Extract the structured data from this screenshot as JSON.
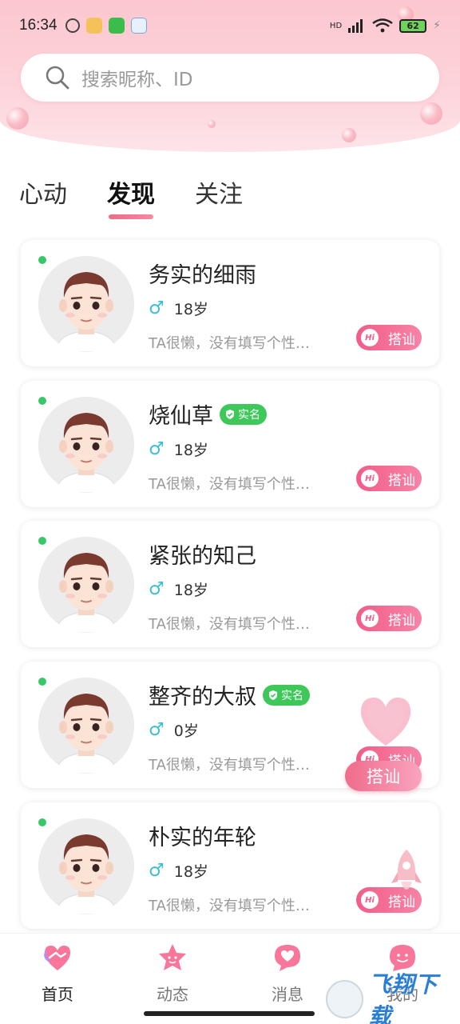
{
  "status_bar": {
    "time": "16:34",
    "signal": "HD",
    "battery": "62"
  },
  "search": {
    "placeholder": "搜索昵称、ID"
  },
  "tabs": [
    {
      "label": "心动",
      "active": false
    },
    {
      "label": "发现",
      "active": true
    },
    {
      "label": "关注",
      "active": false
    }
  ],
  "users": [
    {
      "name": "务实的细雨",
      "verified": false,
      "gender": "♂",
      "age": "18岁",
      "bio": "TA很懒，没有填写个性…",
      "online": true,
      "button": "搭讪",
      "hi": "Hi"
    },
    {
      "name": "烧仙草",
      "verified": true,
      "verified_label": "实名",
      "gender": "♂",
      "age": "18岁",
      "bio": "TA很懒，没有填写个性…",
      "online": true,
      "button": "搭讪",
      "hi": "Hi"
    },
    {
      "name": "紧张的知己",
      "verified": false,
      "gender": "♂",
      "age": "18岁",
      "bio": "TA很懒，没有填写个性…",
      "online": true,
      "button": "搭讪",
      "hi": "Hi"
    },
    {
      "name": "整齐的大叔",
      "verified": true,
      "verified_label": "实名",
      "gender": "♂",
      "age": "0岁",
      "bio": "TA很懒，没有填写个性…",
      "online": true,
      "button": "搭讪",
      "hi": "Hi"
    },
    {
      "name": "朴实的年轮",
      "verified": false,
      "gender": "♂",
      "age": "18岁",
      "bio": "TA很懒，没有填写个性…",
      "online": true,
      "button": "搭讪",
      "hi": "Hi"
    }
  ],
  "floating": {
    "chat_label": "搭讪"
  },
  "bottom_nav": [
    {
      "label": "首页",
      "icon": "handshake-heart-icon",
      "active": true
    },
    {
      "label": "动态",
      "icon": "star-icon",
      "active": false
    },
    {
      "label": "消息",
      "icon": "chat-heart-icon",
      "active": false
    },
    {
      "label": "我的",
      "icon": "face-icon",
      "active": false
    }
  ],
  "watermark": {
    "text": "飞翔下载"
  },
  "colors": {
    "accent": "#f25c88",
    "online": "#38c86a",
    "verified": "#3ec85a",
    "male": "#3bbdd8"
  }
}
